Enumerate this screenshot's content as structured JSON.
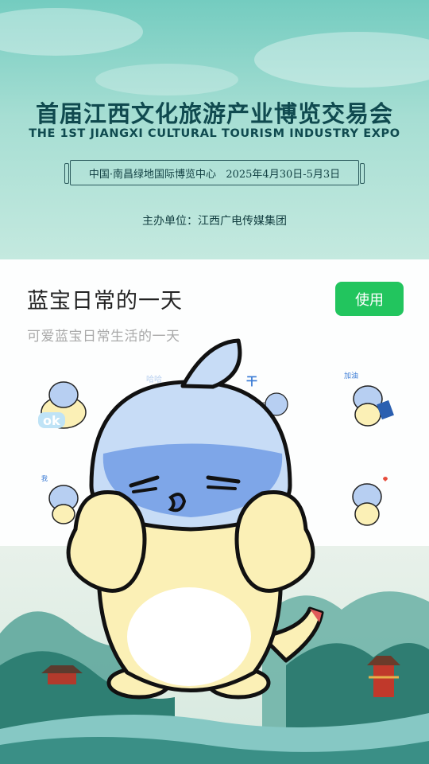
{
  "banner": {
    "title_cn": "首届江西文化旅游产业博览交易会",
    "title_en": "THE 1ST JIANGXI CULTURAL TOURISM INDUSTRY EXPO",
    "venue_dates": "中国·南昌绿地国际博览中心   2025年4月30日-5月3日",
    "organizer": "主办单位：江西广电传媒集团"
  },
  "sticker_pack": {
    "title": "蓝宝日常的一天",
    "subtitle": "可爱蓝宝日常生活的一天",
    "use_button": "使用",
    "thumb_texts": [
      "ok",
      "哈哈",
      "干",
      "加油",
      "我"
    ]
  },
  "colors": {
    "accent_green": "#22c55e",
    "banner_teal": "#74ccc0",
    "mascot_blue": "#8fb6ea",
    "mascot_yellow": "#fbf0b6"
  }
}
